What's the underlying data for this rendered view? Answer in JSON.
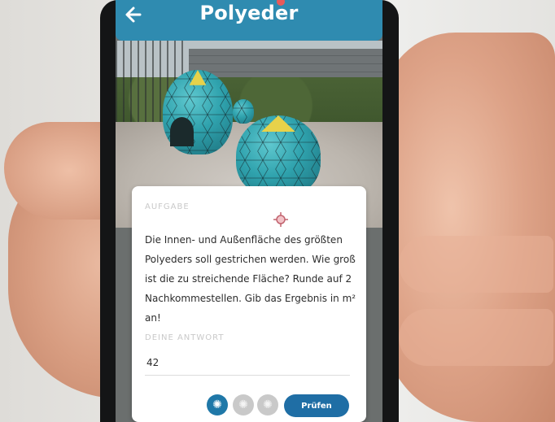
{
  "header": {
    "title": "Polyeder",
    "back_icon": "arrow-left-icon",
    "color": "#2f8bb0"
  },
  "task": {
    "label": "AUFGABE",
    "text": "Die Innen- und Außenfläche des größten Polyeders soll gestrichen werden. Wie groß ist die zu streichende Fläche? Runde auf 2 Nachkommestellen. Gib das Ergebnis in m² an!"
  },
  "answer": {
    "label": "DEINE ANTWORT",
    "value": "42"
  },
  "hints": [
    {
      "icon": "lightbulb-icon",
      "active": true
    },
    {
      "icon": "lightbulb-icon",
      "active": false
    },
    {
      "icon": "lightbulb-icon",
      "active": false
    }
  ],
  "actions": {
    "check_label": "Prüfen",
    "accent": "#1f6ea5"
  }
}
